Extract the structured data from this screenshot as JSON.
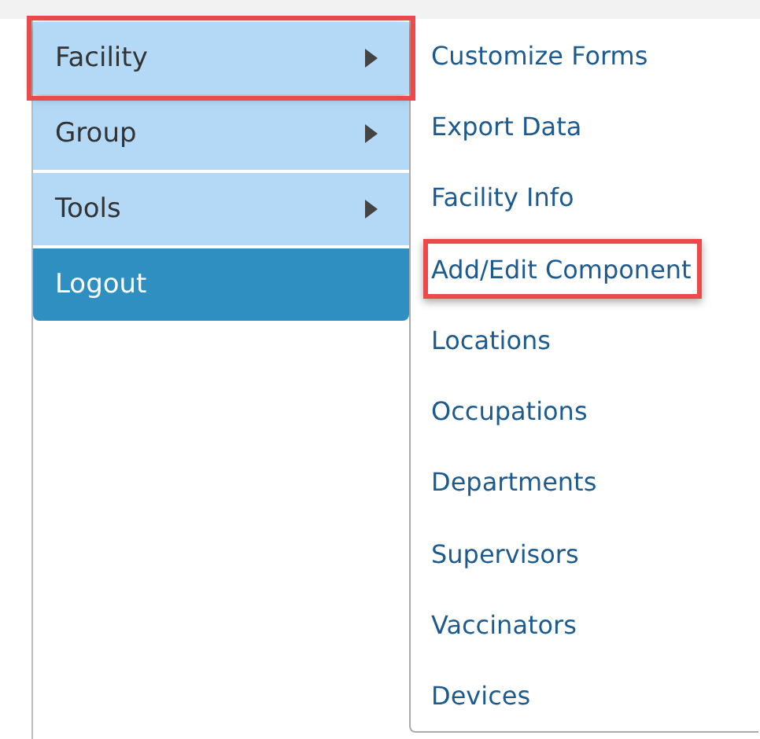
{
  "menu": [
    {
      "label": "Facility",
      "kind": "submenu",
      "highlighted": true
    },
    {
      "label": "Group",
      "kind": "submenu",
      "highlighted": false
    },
    {
      "label": "Tools",
      "kind": "submenu",
      "highlighted": false
    },
    {
      "label": "Logout",
      "kind": "action",
      "highlighted": false
    }
  ],
  "submenu": [
    {
      "label": "Customize Forms",
      "highlighted": false
    },
    {
      "label": "Export Data",
      "highlighted": false
    },
    {
      "label": "Facility Info",
      "highlighted": false
    },
    {
      "label": "Add/Edit Component",
      "highlighted": true
    },
    {
      "label": "Locations",
      "highlighted": false
    },
    {
      "label": "Occupations",
      "highlighted": false
    },
    {
      "label": "Departments",
      "highlighted": false
    },
    {
      "label": "Supervisors",
      "highlighted": false
    },
    {
      "label": "Vaccinators",
      "highlighted": false
    },
    {
      "label": "Devices",
      "highlighted": false
    }
  ]
}
